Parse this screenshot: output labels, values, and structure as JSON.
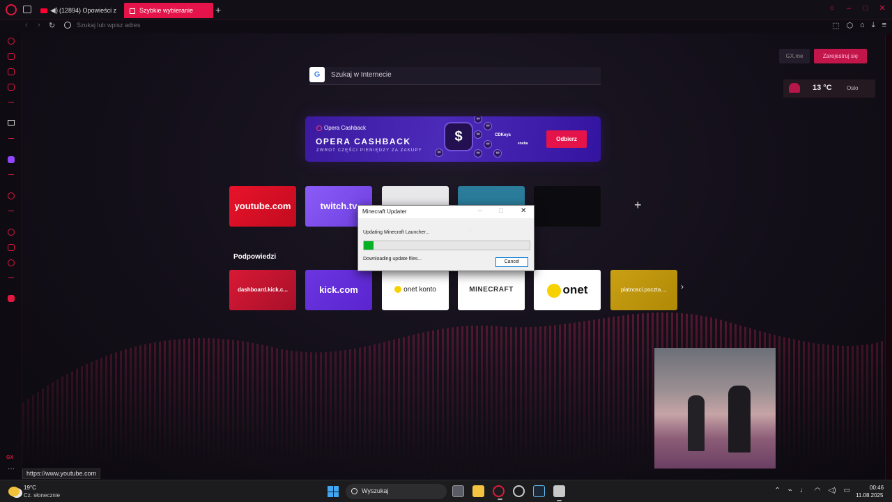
{
  "browser": {
    "tabs": [
      {
        "label": "(12894) Opowieści z",
        "active": false
      },
      {
        "label": "Szybkie wybieranie",
        "active": true
      }
    ],
    "new_tab_symbol": "+",
    "address_placeholder": "Szukaj lub wpisz adres",
    "status_url": "https://www.youtube.com",
    "accent_color": "#e4134a"
  },
  "page": {
    "search_placeholder": "Szukaj w Internecie",
    "gx_links": {
      "gxme": "GX.me",
      "register": "Zarejestruj się"
    },
    "weather": {
      "temp": "13 °C",
      "city": "Oslo",
      "icon": "cloud-icon"
    },
    "banner": {
      "brand": "Opera Cashback",
      "headline": "OPERA CASHBACK",
      "subline": "ZWROT CZĘŚCI PIENIĘDZY ZA ZAKUPY",
      "coin_symbol": "$",
      "partner1": "CDKeys",
      "partner2": "eneba",
      "cta": "Odbierz"
    },
    "speed_dials": [
      {
        "label": "youtube.com"
      },
      {
        "label": "twitch.tv"
      },
      {
        "label": ""
      },
      {
        "label": ""
      },
      {
        "label": ""
      }
    ],
    "add_symbol": "+",
    "suggestions_title": "Podpowiedzi",
    "suggestions": [
      {
        "label": "dashboard.kick.c..."
      },
      {
        "label": "kick.com"
      },
      {
        "label": "onet konto"
      },
      {
        "label": "MINECRAFT"
      },
      {
        "label": "onet"
      },
      {
        "label": "platnosci.poczta...."
      }
    ],
    "next_symbol": "›"
  },
  "dialog": {
    "title": "Minecraft Updater",
    "status": "Updating Minecraft Launcher...",
    "progress": 0.06,
    "detail": "Downloading update files...",
    "cancel": "Cancel",
    "minimize": "–",
    "maximize": "□",
    "close": "✕"
  },
  "taskbar": {
    "weather_temp": "19°C",
    "weather_cond": "Cz. słonecznie",
    "search_label": "Wyszukaj",
    "time": "00:46",
    "date": "11.08.2025"
  }
}
